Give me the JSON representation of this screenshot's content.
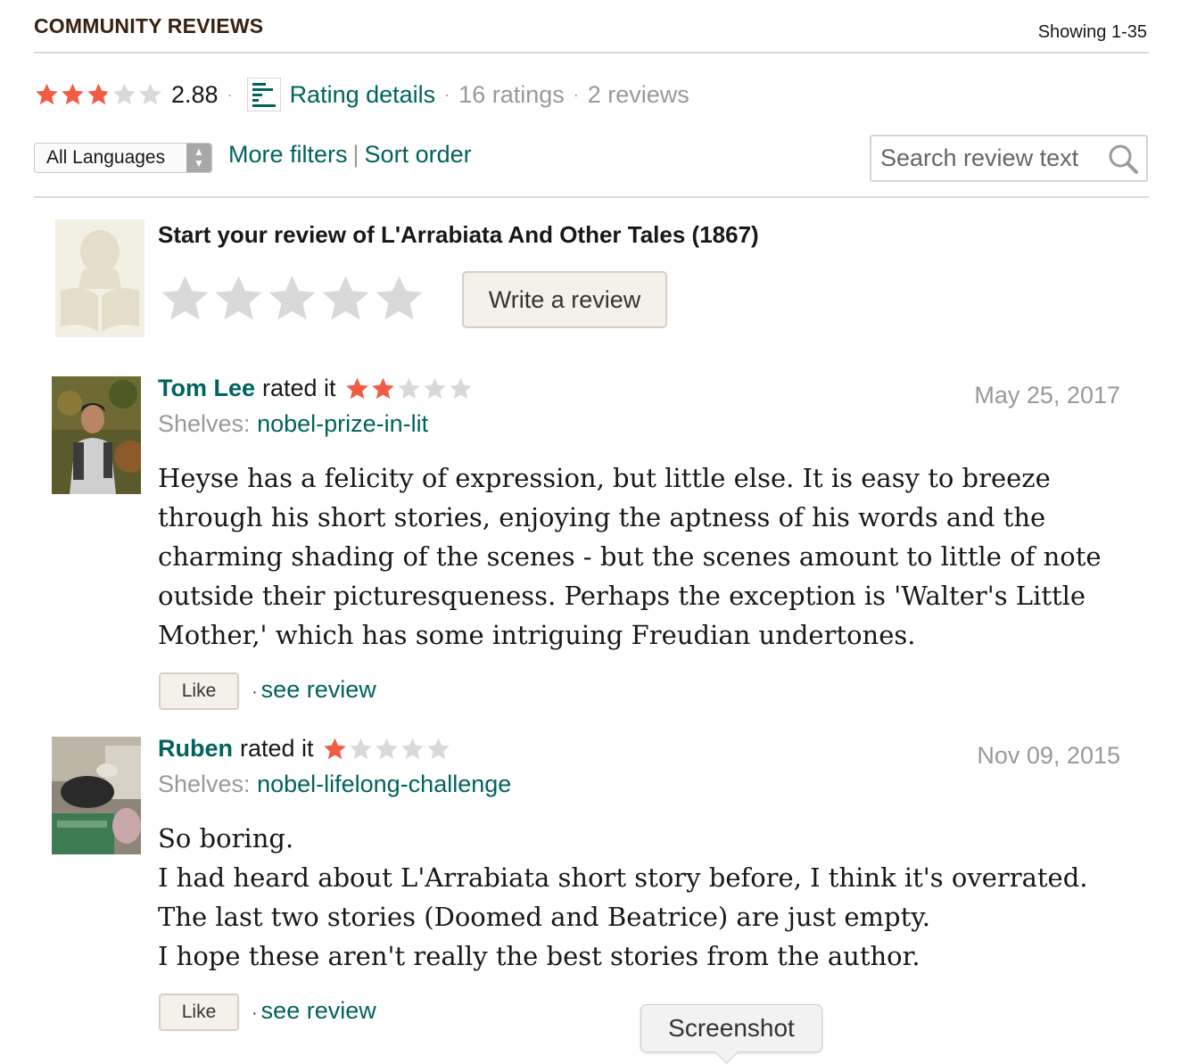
{
  "header": {
    "title": "COMMUNITY REVIEWS",
    "showing": "Showing 1-35"
  },
  "summary": {
    "average_rating": "2.88",
    "average_stars_value": 2.88,
    "rating_details_label": "Rating details",
    "ratings_count": "16 ratings",
    "reviews_count": "2 reviews"
  },
  "filters": {
    "language_selected": "All Languages",
    "more_filters": "More filters",
    "separator": "|",
    "sort_order": "Sort order",
    "search_placeholder": "Search review text"
  },
  "start_review": {
    "title": "Start your review of L'Arrabiata And Other Tales (1867)",
    "write_button": "Write a review"
  },
  "reviews": [
    {
      "name": "Tom Lee",
      "rated_it": "rated it",
      "stars_value": 2,
      "date": "May 25, 2017",
      "shelves_label": "Shelves:",
      "shelf": "nobel-prize-in-lit",
      "body": "Heyse has a felicity of expression, but little else. It is easy to breeze through his short stories, enjoying the aptness of his words and the charming shading of the scenes - but the scenes amount to little of note outside their picturesqueness. Perhaps the exception is 'Walter's Little Mother,' which has some intriguing Freudian undertones.",
      "like": "Like",
      "see_review": "see review"
    },
    {
      "name": "Ruben",
      "rated_it": "rated it",
      "stars_value": 1,
      "date": "Nov 09, 2015",
      "shelves_label": "Shelves:",
      "shelf": "nobel-lifelong-challenge",
      "body_lines": [
        "So boring.",
        "I had heard about L'Arrabiata short story before, I think it's overrated. The last two stories (Doomed and Beatrice) are just empty.",
        "I hope these aren't really the best stories from the author."
      ],
      "like": "Like",
      "see_review": "see review"
    }
  ],
  "tooltip": {
    "label": "Screenshot"
  },
  "colors": {
    "star_filled": "#f25c45",
    "star_empty": "#d9d9d9",
    "link": "#00635d",
    "title": "#382110"
  }
}
